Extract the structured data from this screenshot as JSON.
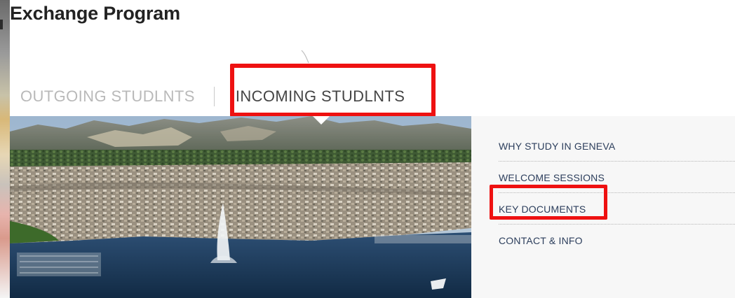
{
  "page": {
    "title": "Exchange Program"
  },
  "tabs": [
    {
      "label": "OUTGOING STUDLNTS",
      "active": false
    },
    {
      "label": "INCOMING STUDLNTS",
      "active": true
    }
  ],
  "side_nav": {
    "items": [
      {
        "label": "WHY STUDY IN GENEVA"
      },
      {
        "label": "WELCOME SESSIONS"
      },
      {
        "label": "KEY DOCUMENTS"
      },
      {
        "label": "CONTACT & INFO"
      }
    ]
  },
  "hero": {
    "icon": "geneva-aerial-photo"
  },
  "colors": {
    "highlight": "#ee1111",
    "nav_text": "#2c3e5c",
    "tab_active": "#454545",
    "tab_inactive": "#b9b9b9"
  }
}
